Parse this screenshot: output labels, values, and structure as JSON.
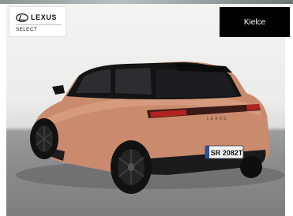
{
  "brand": {
    "name": "LEXUS",
    "sublabel": "SELECT"
  },
  "location_button": {
    "label": "Kielce"
  },
  "vehicle": {
    "plate": "SR 2082T",
    "badge": "LEXUS",
    "paint_color": "#c98a6e",
    "roof_color": "#141414"
  }
}
